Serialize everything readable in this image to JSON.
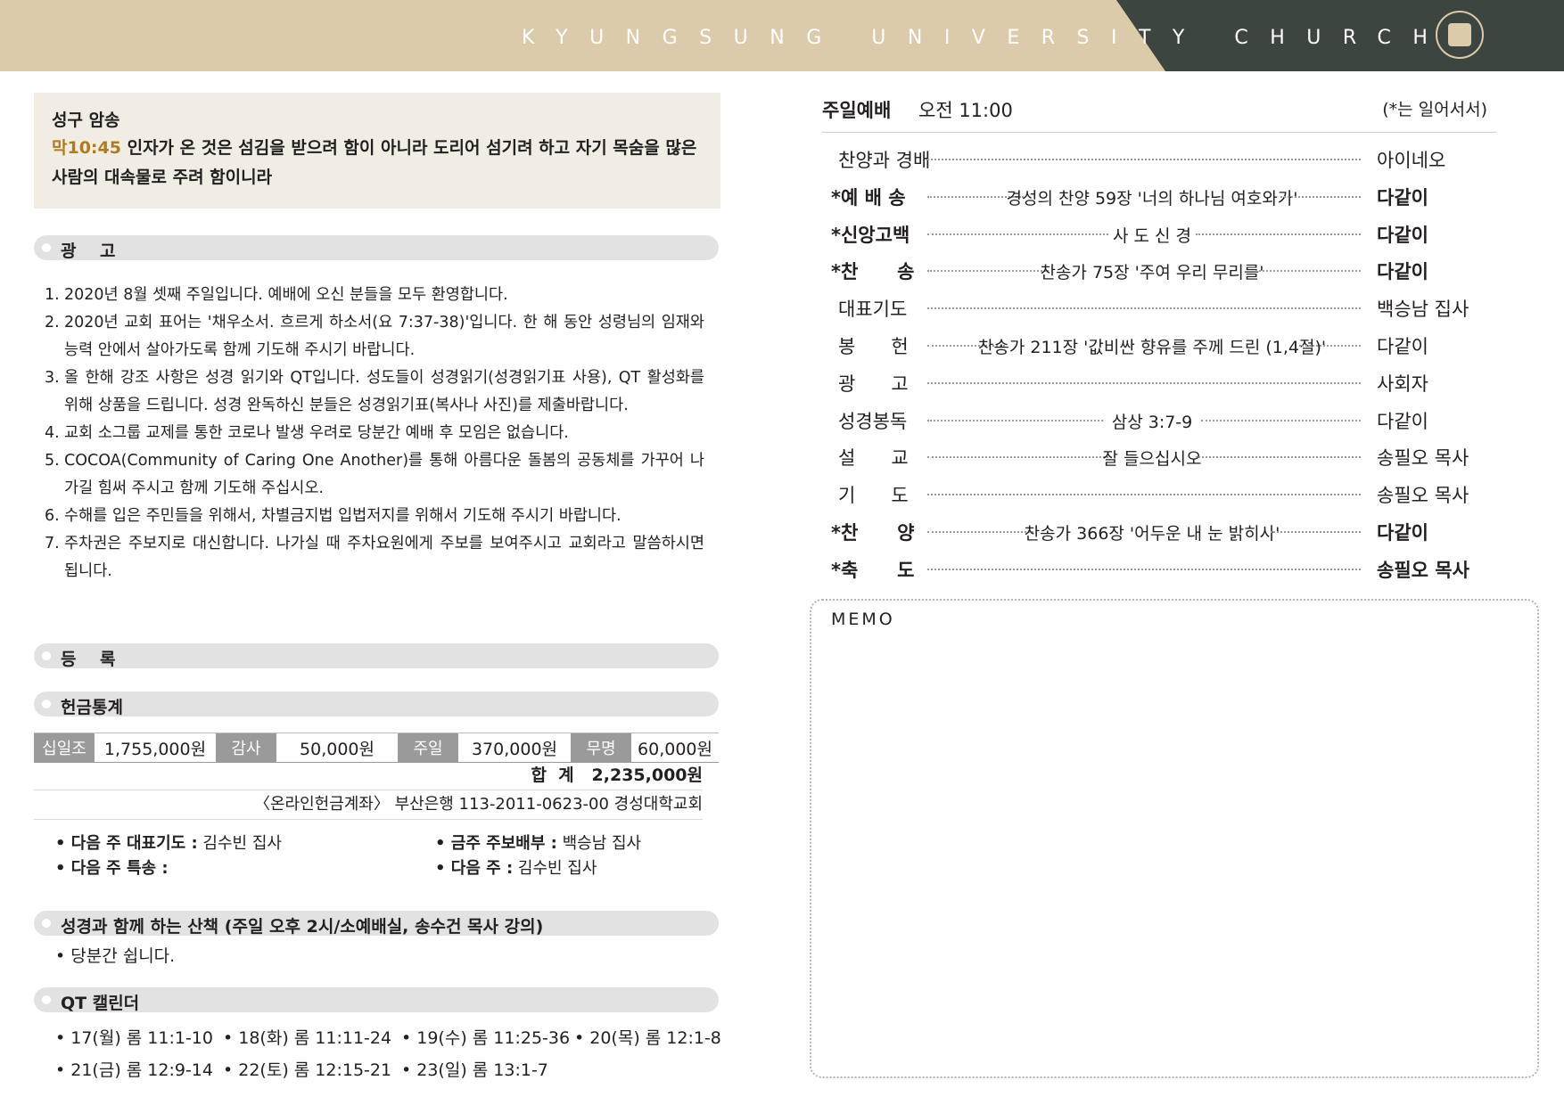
{
  "header": {
    "title": "KYUNGSUNG UNIVERSITY CHURCH",
    "seal_icon": "university-seal"
  },
  "verse": {
    "title": "성구 암송",
    "ref": "막10:45",
    "text": " 인자가 온 것은 섬김을 받으려 함이 아니라 도리어 섬기려 하고 자기 목숨을 많은 사람의 대속물로 주려 함이니라"
  },
  "sections": {
    "announcements": "광    고",
    "registration": "등    록",
    "offering": "헌금통계",
    "bible_walk": "성경과 함께 하는 산책 (주일 오후 2시/소예배실, 송수건 목사 강의)",
    "qt": "QT 캘린더"
  },
  "announcements": [
    {
      "num": "1.",
      "text": "2020년 8월 셋째 주일입니다. 예배에 오신 분들을 모두 환영합니다."
    },
    {
      "num": "2.",
      "text": "2020년 교회 표어는 '채우소서. 흐르게 하소서(요 7:37-38)'입니다. 한 해 동안 성령님의 임재와 능력 안에서 살아가도록 함께 기도해 주시기 바랍니다."
    },
    {
      "num": "3.",
      "text": "올 한해 강조 사항은 성경 읽기와 QT입니다. 성도들이 성경읽기(성경읽기표 사용), QT 활성화를 위해 상품을 드립니다. 성경 완독하신 분들은 성경읽기표(복사나 사진)를 제출바랍니다."
    },
    {
      "num": "4.",
      "text": "교회 소그룹 교제를 통한 코로나 발생 우려로 당분간 예배 후 모임은 없습니다."
    },
    {
      "num": "5.",
      "text": "COCOA(Community of Caring One Another)를 통해 아름다운 돌봄의 공동체를 가꾸어 나가길 힘써 주시고 함께 기도해 주십시오."
    },
    {
      "num": "6.",
      "text": "수해를 입은 주민들을 위해서, 차별금지법 입법저지를 위해서 기도해 주시기 바랍니다."
    },
    {
      "num": "7.",
      "text": "주차권은 주보지로 대신합니다. 나가실 때 주차요원에게 주보를 보여주시고 교회라고 말씀하시면 됩니다."
    }
  ],
  "offering": {
    "items": [
      {
        "label": "십일조",
        "value": "1,755,000원"
      },
      {
        "label": "감사",
        "value": "50,000원"
      },
      {
        "label": "주일",
        "value": "370,000원"
      },
      {
        "label": "무명",
        "value": "60,000원"
      }
    ],
    "total_label": "합  계",
    "total_value": "2,235,000원",
    "account": "〈온라인헌금계좌〉 부산은행 113-2011-0623-00 경성대학교회"
  },
  "info": {
    "next_prayer_label": "• 다음 주 대표기도 :",
    "next_prayer_value": " 김수빈 집사",
    "next_special_label": "• 다음 주 특송 :",
    "next_special_value": "",
    "bulletin_label": "• 금주 주보배부 :",
    "bulletin_value": " 백승남 집사",
    "next_week_label": "• 다음 주 :",
    "next_week_value": " 김수빈 집사"
  },
  "bible_walk_note": "• 당분간 쉽니다.",
  "qt_calendar": [
    "• 17(월) 롬 11:1-10",
    "• 18(화) 롬 11:11-24",
    "• 19(수) 롬 11:25-36",
    "• 20(목) 롬 12:1-8",
    "• 21(금) 롬 12:9-14",
    "• 22(토) 롬 12:15-21",
    "• 23(일) 롬 13:1-7"
  ],
  "service": {
    "title": "주일예배",
    "time": "오전 11:00",
    "note": "(*는 일어서서)",
    "order": [
      {
        "label": "찬양과 경배",
        "center": "",
        "right": "아이네오",
        "bold": false
      },
      {
        "label": "*예 배 송",
        "center": "경성의 찬양 59장 '너의 하나님 여호와가'",
        "right": "다같이",
        "bold": true
      },
      {
        "label": "*신앙고백",
        "center": "사 도 신 경",
        "right": "다같이",
        "bold": true
      },
      {
        "label": "*찬      송",
        "center": "찬송가 75장 '주여 우리 무리를'",
        "right": "다같이",
        "bold": true
      },
      {
        "label": "대표기도",
        "center": "",
        "right": "백승남 집사",
        "bold": false
      },
      {
        "label": "봉      헌",
        "center": "찬송가 211장 '값비싼 향유를 주께 드린 (1,4절)'",
        "right": "다같이",
        "bold": false
      },
      {
        "label": "광      고",
        "center": "",
        "right": "사회자",
        "bold": false
      },
      {
        "label": "성경봉독",
        "center": "삼상 3:7-9",
        "right": "다같이",
        "bold": false
      },
      {
        "label": "설      교",
        "center": "잘 들으십시오",
        "right": "송필오 목사",
        "bold": false
      },
      {
        "label": "기      도",
        "center": "",
        "right": "송필오 목사",
        "bold": false
      },
      {
        "label": "*찬      양",
        "center": "찬송가 366장 '어두운 내 눈 밝히사'",
        "right": "다같이",
        "bold": true
      },
      {
        "label": "*축      도",
        "center": "",
        "right": "송필오 목사",
        "bold": true
      }
    ]
  },
  "memo": {
    "label": "MEMO"
  },
  "colors": {
    "header_tan": "#dccbab",
    "header_dark": "#3d4541",
    "verse_ref": "#b07a1d",
    "section_bar": "#e3e2e2",
    "offering_label": "#9a9a9a"
  }
}
